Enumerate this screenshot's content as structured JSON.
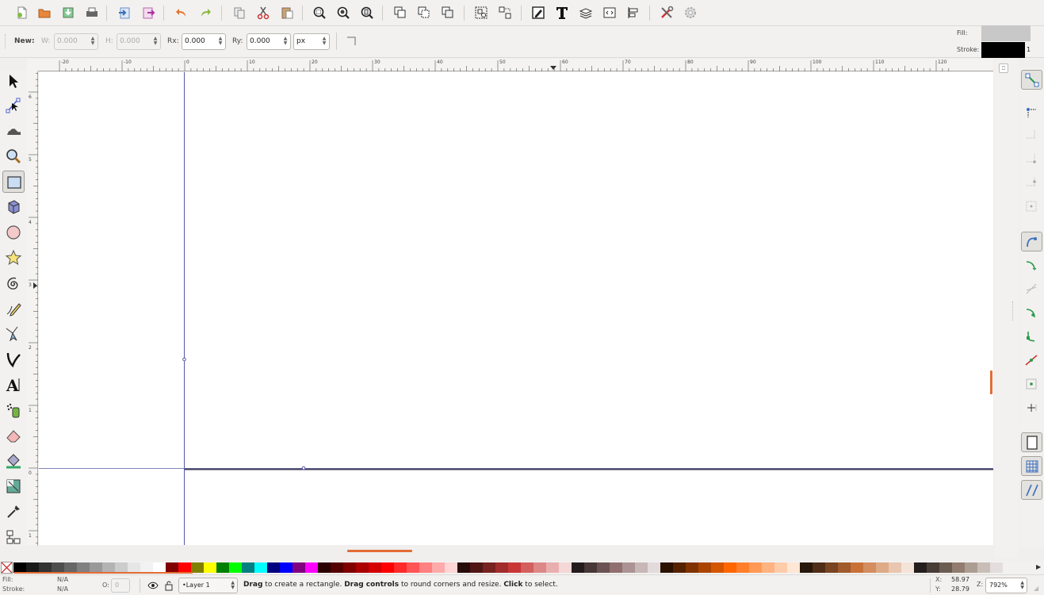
{
  "toolbar": {
    "icons": [
      "new-document-icon",
      "open-icon",
      "save-icon",
      "print-icon",
      "import-icon",
      "export-icon",
      "undo-icon",
      "redo-icon",
      "copy-icon",
      "cut-icon",
      "paste-icon",
      "zoom-selection-icon",
      "zoom-drawing-icon",
      "zoom-page-icon",
      "duplicate-icon",
      "clone-icon",
      "unlink-clone-icon",
      "group-icon",
      "ungroup-icon",
      "fill-stroke-icon",
      "text-font-icon",
      "layers-icon",
      "xml-editor-icon",
      "align-icon",
      "preferences-icon",
      "document-properties-icon"
    ]
  },
  "controls": {
    "new_label": "New:",
    "w_label": "W:",
    "w_value": "0.000",
    "h_label": "H:",
    "h_value": "0.000",
    "rx_label": "Rx:",
    "rx_value": "0.000",
    "ry_label": "Ry:",
    "ry_value": "0.000",
    "unit": "px",
    "fill_label": "Fill:",
    "stroke_label": "Stroke:",
    "stroke_width": "1",
    "fill_color": "#c8c8c8",
    "stroke_color": "#000000"
  },
  "rulers": {
    "horizontal_ticks": [
      "-20",
      "-10",
      "0",
      "10",
      "20",
      "30",
      "40",
      "50",
      "60",
      "70",
      "80",
      "90",
      "100",
      "110",
      "120"
    ],
    "vertical_ticks": [
      "6",
      "5",
      "4",
      "3",
      "2",
      "1",
      "0",
      "1"
    ]
  },
  "tools": [
    "selector-tool",
    "node-tool",
    "tweak-tool",
    "zoom-tool",
    "rectangle-tool",
    "3d-box-tool",
    "ellipse-tool",
    "star-tool",
    "spiral-tool",
    "pencil-tool",
    "pen-tool",
    "calligraphy-tool",
    "text-tool",
    "spray-tool",
    "eraser-tool",
    "paint-bucket-tool",
    "gradient-tool",
    "dropper-tool",
    "connector-tool"
  ],
  "palette": {
    "colors": [
      "#000000",
      "#1a1a1a",
      "#333333",
      "#4d4d4d",
      "#666666",
      "#808080",
      "#999999",
      "#b3b3b3",
      "#cccccc",
      "#e6e6e6",
      "#f2f2f2",
      "#ffffff",
      "#800000",
      "#ff0000",
      "#808000",
      "#ffff00",
      "#008000",
      "#00ff00",
      "#008080",
      "#00ffff",
      "#000080",
      "#0000ff",
      "#800080",
      "#ff00ff",
      "#2b0000",
      "#550000",
      "#800000",
      "#aa0000",
      "#d40000",
      "#ff0000",
      "#ff2a2a",
      "#ff5555",
      "#ff8080",
      "#ffaaaa",
      "#ffd5d5",
      "#280b0b",
      "#501616",
      "#782121",
      "#a02c2c",
      "#c83737",
      "#d35f5f",
      "#de8787",
      "#e9afaf",
      "#f4d7d7",
      "#241c1c",
      "#483737",
      "#6c5353",
      "#916f6f",
      "#ac9393",
      "#c8b7b7",
      "#e3dbdb",
      "#2b1100",
      "#552200",
      "#803300",
      "#aa4400",
      "#d45500",
      "#ff6600",
      "#ff7f2a",
      "#ff9955",
      "#ffb380",
      "#ffccaa",
      "#ffe6d5",
      "#28170b",
      "#502d16",
      "#784421",
      "#a05a2c",
      "#c87137",
      "#d38d5f",
      "#deaa87",
      "#e9c6af",
      "#f4e3d7",
      "#241f1c",
      "#483e37",
      "#6c5d53",
      "#917c6f",
      "#ac9d93",
      "#c8beb7",
      "#e3dedb"
    ]
  },
  "status": {
    "fill_label": "Fill:",
    "fill_value": "N/A",
    "stroke_label": "Stroke:",
    "stroke_value": "N/A",
    "opacity_label": "O:",
    "opacity_value": "0",
    "layer": "•Layer 1",
    "msg_drag1": "Drag",
    "msg_t1": " to create a rectangle. ",
    "msg_drag2": "Drag controls",
    "msg_t2": " to round corners and resize. ",
    "msg_click": "Click",
    "msg_t3": " to select.",
    "x_label": "X:",
    "x_value": "58.97",
    "y_label": "Y:",
    "y_value": "28.79",
    "z_label": "Z:",
    "zoom": "792%"
  }
}
